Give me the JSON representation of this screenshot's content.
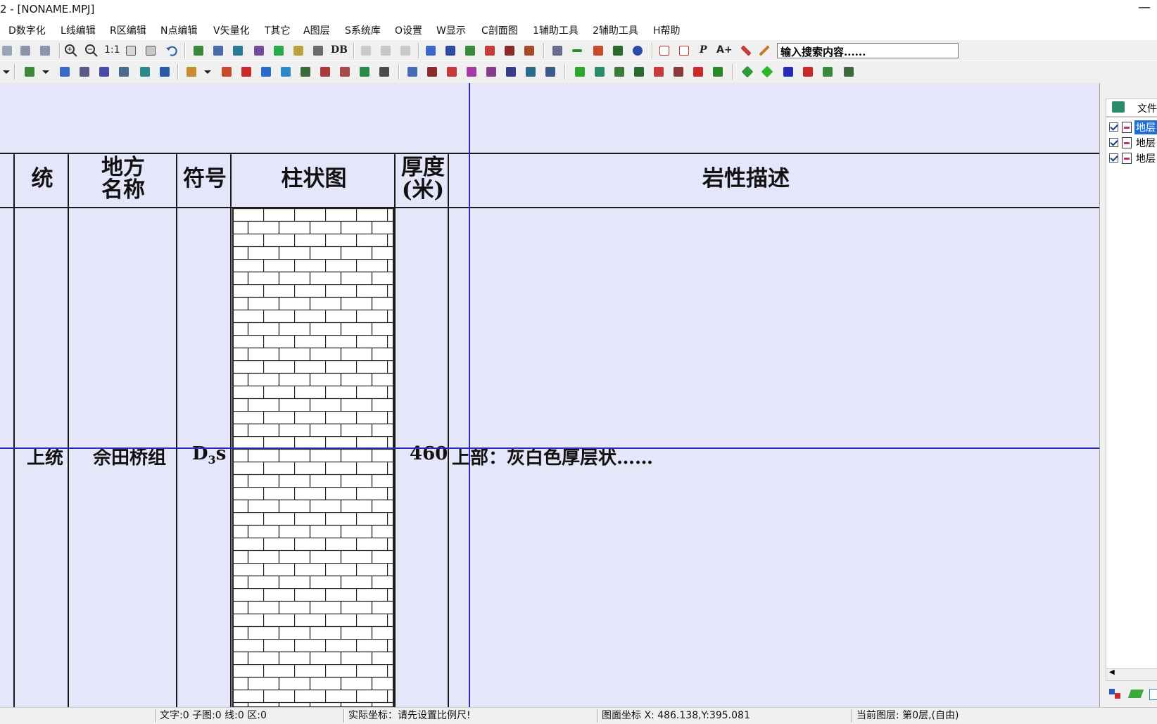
{
  "window": {
    "title": "2 - [NONAME.MPJ]",
    "minimize_glyph": "—"
  },
  "menu": [
    "D数字化",
    "L线编辑",
    "R区编辑",
    "N点编辑",
    "V矢量化",
    "T其它",
    "A图层",
    "S系统库",
    "O设置",
    "W显示",
    "C剖面图",
    "1辅助工具",
    "2辅助工具",
    "H帮助"
  ],
  "toolbar1": {
    "zoom_ratio_label": "1:1",
    "db_label": "DB",
    "p_label": "P",
    "a_plus_label": "A+",
    "search_value": "输入搜索内容......"
  },
  "table": {
    "headers": {
      "system": "统",
      "local_name_line1": "地方",
      "local_name_line2": "名称",
      "symbol": "符号",
      "column_chart": "柱状图",
      "thickness_line1": "厚度",
      "thickness_line2": "(米)",
      "lithology": "岩性描述"
    },
    "row": {
      "system": "上统",
      "local_name": "佘田桥组",
      "symbol_main": "D",
      "symbol_sub": "3",
      "symbol_tail": "s",
      "thickness": "460",
      "lithology": "上部：灰白色厚层状……"
    }
  },
  "right_panel": {
    "tab_label": "文件",
    "layers": [
      {
        "label": "地层",
        "selected": true
      },
      {
        "label": "地层",
        "selected": false
      },
      {
        "label": "地层",
        "selected": false
      }
    ],
    "scroll_left_glyph": "◀"
  },
  "statusbar": {
    "counts": "文字:0 子图:0 线:0 区:0",
    "real_coords": "实际坐标：请先设置比例尺!",
    "map_coords": "图面坐标 X: 486.138,Y:395.081",
    "current_layer": "当前图层: 第0层,(自由)"
  },
  "colors": {
    "canvas_bg": "#e6e6fa",
    "crosshair": "#2a2ab8",
    "selection": "#1f6fd6"
  }
}
